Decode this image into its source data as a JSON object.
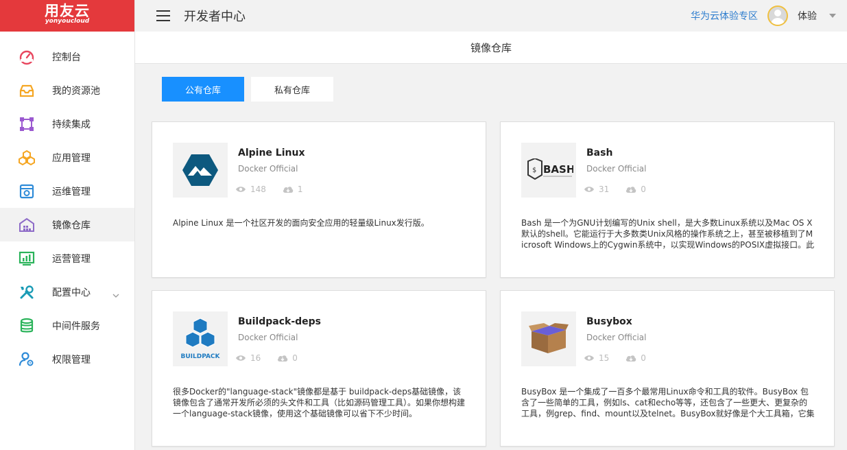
{
  "brand": {
    "name": "用友云",
    "sub": "yonyoucloud",
    "color": "#e4393c"
  },
  "header": {
    "title": "开发者中心",
    "zone_link": "华为云体验专区",
    "user": "体验"
  },
  "sidebar": {
    "items": [
      {
        "label": "控制台",
        "icon": "dashboard-icon",
        "color": "#e8465e"
      },
      {
        "label": "我的资源池",
        "icon": "inbox-icon",
        "color": "#f5a623"
      },
      {
        "label": "持续集成",
        "icon": "pipeline-icon",
        "color": "#9b59d0"
      },
      {
        "label": "应用管理",
        "icon": "boxes-icon",
        "color": "#f5a623"
      },
      {
        "label": "运维管理",
        "icon": "ops-icon",
        "color": "#2e8bd8"
      },
      {
        "label": "镜像仓库",
        "icon": "warehouse-icon",
        "color": "#8e6cc8"
      },
      {
        "label": "运营管理",
        "icon": "monitor-chart-icon",
        "color": "#2ab35a"
      },
      {
        "label": "配置中心",
        "icon": "tools-icon",
        "color": "#1a9bb5"
      },
      {
        "label": "中间件服务",
        "icon": "database-icon",
        "color": "#2ab35a"
      },
      {
        "label": "权限管理",
        "icon": "user-settings-icon",
        "color": "#2e8bd8"
      }
    ]
  },
  "page": {
    "title": "镜像仓库"
  },
  "tabs": [
    {
      "label": "公有仓库"
    },
    {
      "label": "私有仓库"
    }
  ],
  "cards": [
    {
      "name": "Alpine Linux",
      "org": "Docker Official",
      "views": "148",
      "downloads": "1",
      "desc": "Alpine Linux 是一个社区开发的面向安全应用的轻量级Linux发行版。"
    },
    {
      "name": "Bash",
      "org": "Docker Official",
      "views": "31",
      "downloads": "0",
      "desc": "Bash 是一个为GNU计划编写的Unix shell，是大多数Linux系统以及Mac OS X默认的shell。它能运行于大多数类Unix风格的操作系统之上，甚至被移植到了Microsoft Windows上的Cygwin系统中，以实现Windows的POSIX虚拟接口。此"
    },
    {
      "name": "Buildpack-deps",
      "org": "Docker Official",
      "views": "16",
      "downloads": "0",
      "desc": "很多Docker的\"language-stack\"镜像都是基于 buildpack-deps基础镜像，该镜像包含了通常开发所必须的头文件和工具（比如源码管理工具）。如果你想构建一个language-stack镜像，使用这个基础镜像可以省下不少时间。"
    },
    {
      "name": "Busybox",
      "org": "Docker Official",
      "views": "15",
      "downloads": "0",
      "desc": "BusyBox 是一个集成了一百多个最常用Linux命令和工具的软件。BusyBox 包含了一些简单的工具，例如ls、cat和echo等等，还包含了一些更大、更复杂的工具，例grep、find、mount以及telnet。BusyBox就好像是个大工具箱，它集成压"
    }
  ],
  "logos": {
    "bash": "BASH",
    "buildpack": "BUILDPACK"
  },
  "colors": {
    "accent": "#1890ff",
    "link": "#2e7dce",
    "alpine": "#0d597f"
  }
}
